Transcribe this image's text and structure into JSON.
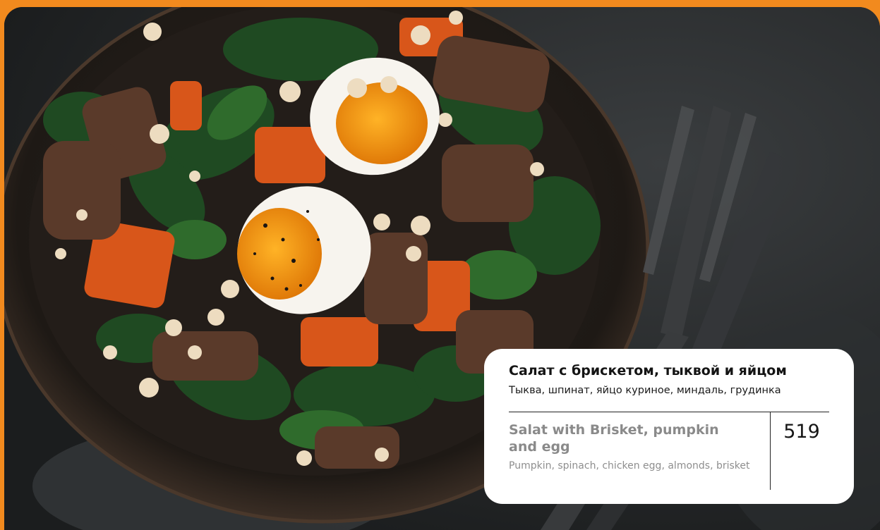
{
  "colors": {
    "frame_orange": "#f28a1e",
    "card_background": "#ffffff",
    "title_dark": "#141414",
    "english_gray": "#8a8a8a"
  },
  "photo": {
    "subject": "salad-with-brisket-pumpkin-egg-photo"
  },
  "menu_card": {
    "title_ru": "Салат с брискетом, тыквой и яйцом",
    "ingredients_ru": "Тыква, шпинат, яйцо куриное, миндаль, грудинка",
    "title_en": "Salat with Brisket, pumpkin and egg",
    "ingredients_en": "Pumpkin, spinach, chicken egg, almonds, brisket",
    "price": "519"
  }
}
